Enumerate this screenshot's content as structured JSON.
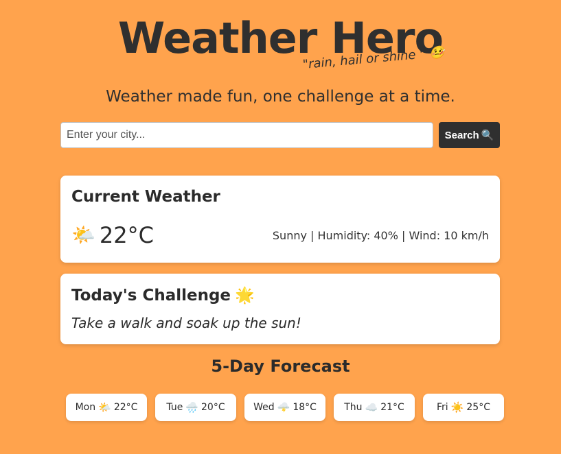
{
  "header": {
    "title": "Weather Hero",
    "tagline": "\"rain, hail or shine \"",
    "tagline_emoji": "🤒",
    "subtitle": "Weather made fun, one challenge at a time."
  },
  "search": {
    "placeholder": "Enter your city...",
    "value": "",
    "button_label": "Search",
    "button_icon": "🔍"
  },
  "current_weather": {
    "title": "Current Weather",
    "icon": "🌤️",
    "temperature": "22°C",
    "details": "Sunny | Humidity: 40% | Wind: 10 km/h"
  },
  "challenge": {
    "title": "Today's Challenge",
    "icon": "🌟",
    "text": "Take a walk and soak up the sun!"
  },
  "forecast": {
    "title": "5-Day Forecast",
    "days": [
      {
        "day": "Mon",
        "icon": "🌤️",
        "temp": "22°C"
      },
      {
        "day": "Tue",
        "icon": "🌧️",
        "temp": "20°C"
      },
      {
        "day": "Wed",
        "icon": "🌩️",
        "temp": "18°C"
      },
      {
        "day": "Thu",
        "icon": "☁️",
        "temp": "21°C"
      },
      {
        "day": "Fri",
        "icon": "☀️",
        "temp": "25°C"
      }
    ]
  },
  "colors": {
    "background": "#ffa34d",
    "button": "#2f2f2f",
    "card": "#ffffff",
    "text": "#2b2b2b"
  }
}
